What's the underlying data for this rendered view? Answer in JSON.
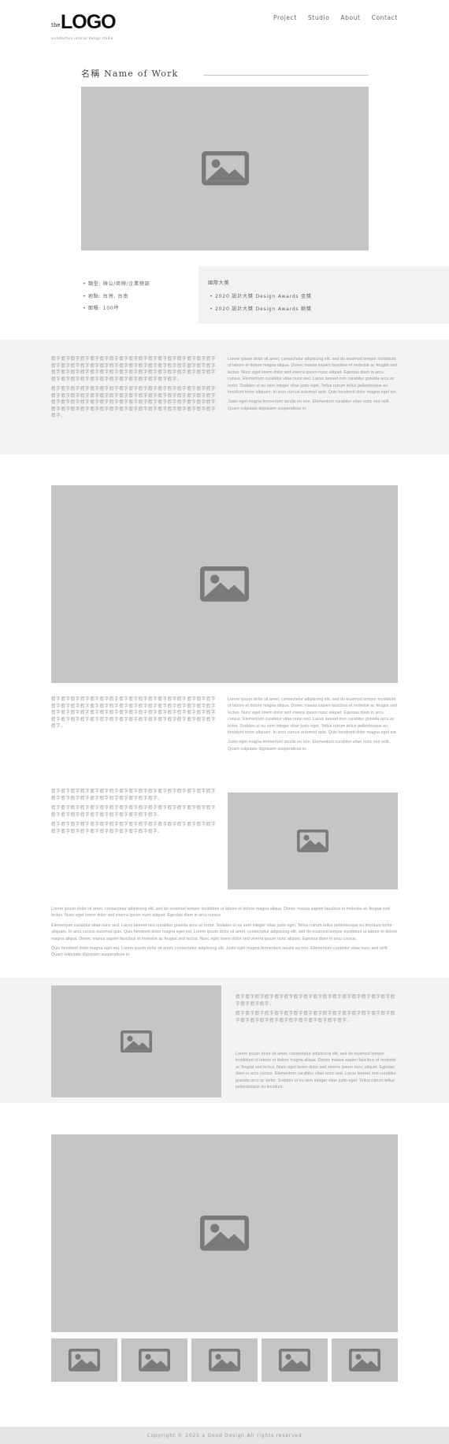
{
  "header": {
    "logo_small": "the",
    "logo_word": "LOGO",
    "logo_tagline": "architecture interior design studio",
    "nav": [
      "Project",
      "Studio",
      "About",
      "Contact"
    ]
  },
  "work": {
    "title": "名稱 Name of Work"
  },
  "facts": [
    "類型: 辦公/商辦/企業總部",
    "地點: 台灣, 台南",
    "面積: 100坪"
  ],
  "awards": {
    "heading": "國際大獎",
    "items": [
      "2020 設計大獎 Design Awards 金獎",
      "2020 設計大獎 Design Awards 銅獎"
    ]
  },
  "text": {
    "zh_long": "假字假字假字假字假字假字假字假字假字假字假字假字假字假字假字假字假字假字假字假字假字假字假字假字假字假字假字假字假字假字假字假字假字假字假字假字假字假字假字假字假字假字假字假字假字假字假字假字假字假字假字假字假字假字假字假字假字假字假字假字假字假字假字假字假字假字假字假字假字。",
    "zh_mid": "假字假字假字假字假字假字假字假字假字假字假字假字假字假字假字假字假字假字假字假字假字假字假字假字假字假字假字假字假字假字假字假字假字假字假字假字假字假字假字假字假字假字假字假字假字假字假字假字假字假字假字假字假字假字假字假字假字假字假字假字假字假字假字假字。",
    "zh_short": "假字假字假字假字假字假字假字假字假字假字假字假字假字假字假字假字假字假字假字假字假字假字假字假字假字假字假字假字。",
    "zh_tiny": "假字假字假字假字假字假字假字假字假字假字假字假字假字假字假字假字假字假字假字假字。",
    "en_long": "Lorem ipsum dolor sit amet, consectetur adipiscing elit, sed do eiusmod tempor incididunt ut labore et dolore magna aliqua. Donec massa sapien faucibus et molestie ac feugiat sed lectus. Nunc eget lorem dolor sed viverra ipsum nunc aliquet. Egestas diam in arcu cursus. Elementum curabitur vitae nunc sed. Lacus laoreet non curabitur gravida arcu ac tortor. Sodales ut eu sem integer vitae justo eget. Tellus rutrum tellus pellentesque eu tincidunt tortor aliquam. In arcu cursus euismod quis. Quis hendrerit dolor magna eget est.",
    "en_short": "Justo eget magna fermentum iaculis eu non. Elementum curabitur vitae nunc sed velit. Quam vulputate dignissim suspendisse in.",
    "en_wide_1": "Lorem ipsum dolor sit amet, consectetur adipiscing elit, sed do eiusmod tempor incididunt ut labore et dolore magna aliqua. Donec massa sapien faucibus et molestie ac feugiat sed lectus. Nunc eget lorem dolor sed viverra ipsum nunc aliquet. Egestas diam in arcu cursus.",
    "en_wide_2": "Elementum curabitur vitae nunc sed. Lacus laoreet non curabitur gravida arcu ac tortor. Sodales ut eu sem integer vitae justo eget. Tellus rutrum tellus pellentesque eu tincidunt tortor aliquam. In arcu cursus euismod quis. Quis hendrerit dolor magna eget est. Lorem ipsum dolor sit amet, consectetur adipiscing elit, sed do eiusmod tempor incididunt ut labore et dolore magna aliqua. Donec massa sapien faucibus et molestie ac feugiat sed lectus. Nunc eget lorem dolor sed viverra ipsum nunc aliquet. Egestas diam in arcu cursus.",
    "en_wide_3": "Quis hendrerit dolor magna eget est. Lorem ipsum dolor sit amet, consectetur adipiscing elit, Justo eget magna fermentum iaculis eu non. Elementum curabitur vitae nunc sed velit. Quam vulputate dignissim suspendisse in.",
    "en_band": "Lorem ipsum dolor sit amet, consectetur adipiscing elit, sed do eiusmod tempor incididunt ut labore et dolore magna aliqua. Donec massa sapien faucibus et molestie ac feugiat sed lectus. Nunc eget lorem dolor sed viverra ipsum nunc aliquet. Egestas diam in arcu cursus. Elementum curabitur vitae nunc sed. Lacus laoreet non curabitur gravida arcu ac tortor. Sodales ut eu sem integer vitae justo eget. Tellus rutrum tellus pellentesque eu tincidunt."
  },
  "footer": {
    "copyright": "Copyright © 2021 a Good Design All rights reserved"
  },
  "colors": {
    "placeholder_bg": "#c5c5c5",
    "placeholder_icon": "#7a7a7a",
    "band_bg": "#f3f3f3",
    "footer_bg": "#e6e6e6"
  },
  "icons": {
    "image_placeholder": "image-icon"
  }
}
